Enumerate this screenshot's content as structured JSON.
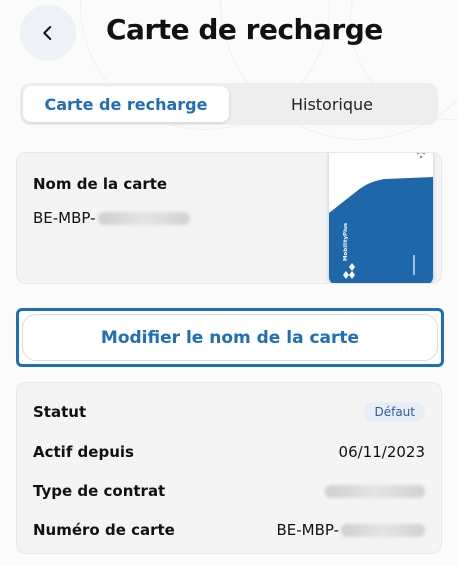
{
  "header": {
    "title": "Carte de recharge"
  },
  "tabs": [
    {
      "label": "Carte de recharge",
      "active": true
    },
    {
      "label": "Historique",
      "active": false
    }
  ],
  "card": {
    "name_label": "Nom de la carte",
    "name_value_prefix": "BE-MBP-",
    "brand_text": "MobilityPlus"
  },
  "modify_button": {
    "label": "Modifier le nom de la carte"
  },
  "details": [
    {
      "label": "Statut",
      "value": "Défaut",
      "kind": "badge"
    },
    {
      "label": "Actif depuis",
      "value": "06/11/2023",
      "kind": "text"
    },
    {
      "label": "Type de contrat",
      "value": "",
      "kind": "blurred"
    },
    {
      "label": "Numéro de carte",
      "value": "BE-MBP-",
      "kind": "text-blurred"
    }
  ],
  "colors": {
    "accent": "#1e6fb8",
    "card_blue": "#1f67ab",
    "badge_bg": "#e8edf7"
  }
}
